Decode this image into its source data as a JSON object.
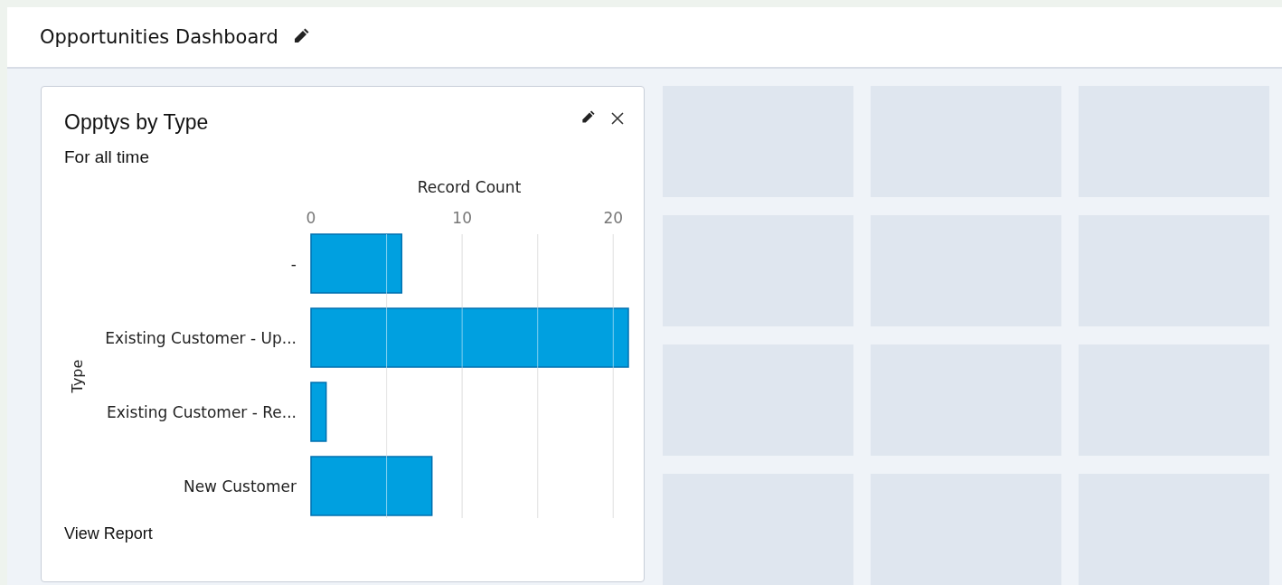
{
  "header": {
    "title": "Opportunities Dashboard"
  },
  "widget": {
    "title": "Opptys by Type",
    "subtitle": "For all time",
    "link": "View Report",
    "chart_data": {
      "type": "bar",
      "orientation": "horizontal",
      "xlabel": "Record Count",
      "ylabel": "Type",
      "categories": [
        "-",
        "Existing Customer - Up...",
        "Existing Customer - Re...",
        "New Customer"
      ],
      "series": [
        {
          "color": "#00a0e0",
          "values": [
            6,
            21,
            1,
            8
          ]
        }
      ],
      "grid": true,
      "xlim": [
        0,
        21
      ],
      "xticks": [
        0,
        10,
        20
      ]
    }
  }
}
